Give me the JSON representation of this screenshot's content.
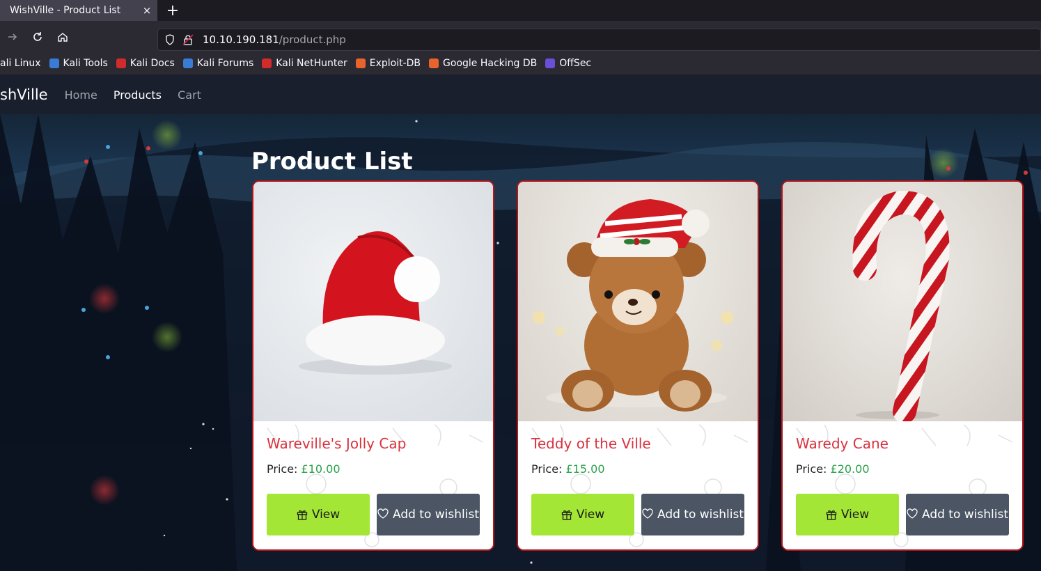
{
  "browser": {
    "tab_title": "WishVille - Product List",
    "close_glyph": "×",
    "newtab_glyph": "+",
    "url_host": "10.10.190.181",
    "url_path": "/product.php"
  },
  "bookmarks": [
    {
      "label": "ali Linux",
      "color": "#367bf0"
    },
    {
      "label": "Kali Tools",
      "color": "#3a7bd5"
    },
    {
      "label": "Kali Docs",
      "color": "#d12b2b"
    },
    {
      "label": "Kali Forums",
      "color": "#3a7bd5"
    },
    {
      "label": "Kali NetHunter",
      "color": "#d12b2b"
    },
    {
      "label": "Exploit-DB",
      "color": "#e8642c"
    },
    {
      "label": "Google Hacking DB",
      "color": "#e8642c"
    },
    {
      "label": "OffSec",
      "color": "#6b4fd9"
    }
  ],
  "site": {
    "brand": "shVille",
    "nav": {
      "home": "Home",
      "products": "Products",
      "cart": "Cart"
    },
    "page_title": "Product List"
  },
  "products": [
    {
      "name": "Wareville's Jolly Cap",
      "price_label": "Price:",
      "price": "£10.00",
      "view": "View",
      "wish": "Add to wishlist"
    },
    {
      "name": "Teddy of the Ville",
      "price_label": "Price:",
      "price": "£15.00",
      "view": "View",
      "wish": "Add to wishlist"
    },
    {
      "name": "Waredy Cane",
      "price_label": "Price:",
      "price": "£20.00",
      "view": "View",
      "wish": "Add to wishlist"
    }
  ],
  "colors": {
    "accent_view": "#a3e635",
    "wishlist_btn": "#4b5563",
    "card_border": "#b3151a",
    "product_name": "#d9313d",
    "price": "#2aa14b"
  }
}
